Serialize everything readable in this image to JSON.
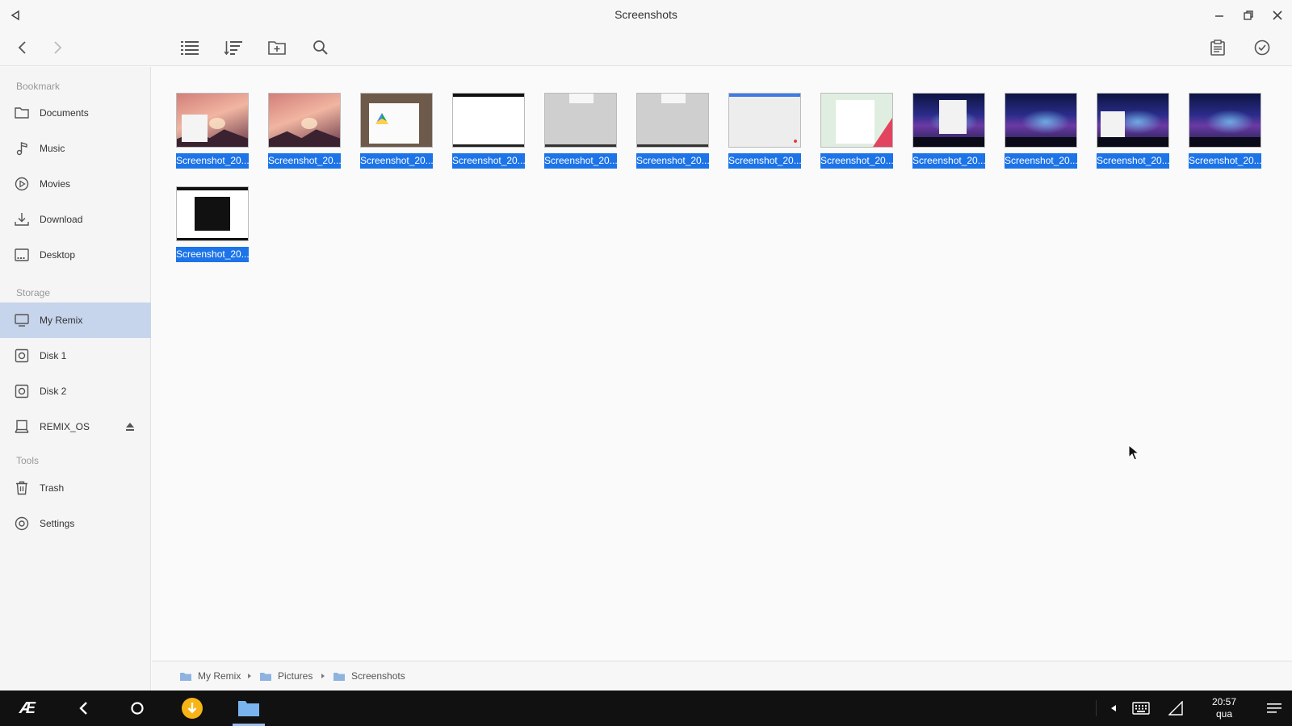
{
  "window": {
    "title": "Screenshots"
  },
  "sidebar": {
    "sections": [
      {
        "heading": "Bookmark"
      },
      {
        "heading": "Storage"
      },
      {
        "heading": "Tools"
      }
    ],
    "items": [
      {
        "label": "Documents",
        "icon": "folder-icon"
      },
      {
        "label": "Music",
        "icon": "music-note-icon"
      },
      {
        "label": "Movies",
        "icon": "play-circle-icon"
      },
      {
        "label": "Download",
        "icon": "download-icon"
      },
      {
        "label": "Desktop",
        "icon": "desktop-icon"
      },
      {
        "label": "My Remix",
        "icon": "monitor-icon",
        "active": true
      },
      {
        "label": "Disk 1",
        "icon": "disk-icon"
      },
      {
        "label": "Disk 2",
        "icon": "disk-icon"
      },
      {
        "label": "REMIX_OS",
        "icon": "drive-icon",
        "eject": true
      },
      {
        "label": "Trash",
        "icon": "trash-icon"
      },
      {
        "label": "Settings",
        "icon": "settings-icon"
      }
    ]
  },
  "files": [
    {
      "name": "Screenshot_20...",
      "thumb": "pink"
    },
    {
      "name": "Screenshot_20...",
      "thumb": "pink"
    },
    {
      "name": "Screenshot_20...",
      "thumb": "drive"
    },
    {
      "name": "Screenshot_20...",
      "thumb": "white"
    },
    {
      "name": "Screenshot_20...",
      "thumb": "grey"
    },
    {
      "name": "Screenshot_20...",
      "thumb": "grey"
    },
    {
      "name": "Screenshot_20...",
      "thumb": "blue"
    },
    {
      "name": "Screenshot_20...",
      "thumb": "green"
    },
    {
      "name": "Screenshot_20...",
      "thumb": "aurora"
    },
    {
      "name": "Screenshot_20...",
      "thumb": "aurora"
    },
    {
      "name": "Screenshot_20...",
      "thumb": "aurora"
    },
    {
      "name": "Screenshot_20...",
      "thumb": "aurora"
    },
    {
      "name": "Screenshot_20...",
      "thumb": "dark"
    }
  ],
  "breadcrumb": [
    "My Remix",
    "Pictures",
    "Screenshots"
  ],
  "taskbar": {
    "time": "20:57",
    "day": "qua",
    "start_label": "Æ"
  },
  "colors": {
    "selection": "#1d74e8",
    "active_item": "#c6d4ec",
    "taskbar": "#111111"
  }
}
